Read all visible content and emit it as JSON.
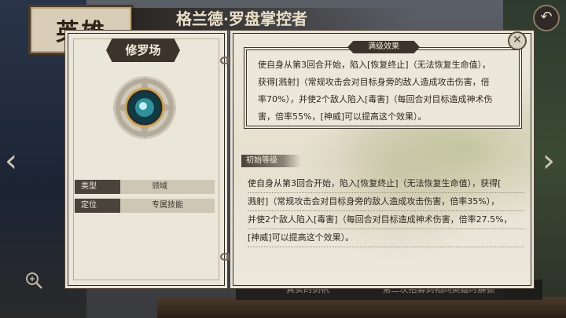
{
  "header": {
    "hero_tab": "英雄",
    "hero_name": "格兰德·罗盘掌控者",
    "back_icon": "↶"
  },
  "skill": {
    "name": "修罗场",
    "info": [
      {
        "key": "类型",
        "value": "领域"
      },
      {
        "key": "定位",
        "value": "专属技能"
      }
    ]
  },
  "max_level": {
    "label": "满级效果",
    "lines": [
      "使自身从第3回合开始，陷入[恢复终止]（无法恢复生命值），",
      "获得[溅射]（常规攻击会对目标身旁的敌人造成攻击伤害，倍",
      "率70%），并使2个敌人陷入[毒害]（每回合对目标造成神术伤",
      "害，倍率55%，[神威]可以提高这个效果）。"
    ]
  },
  "initial_level": {
    "label": "初始等级",
    "lines": [
      "使自身从第3回合开始，陷入[恢复终止]（无法恢复生命值），获得[",
      "溅射]（常规攻击会对目标身旁的敌人造成攻击伤害，倍率35%），",
      "并使2个敌人陷入[毒害]（每回合对目标造成神术伤害，倍率27.5%，",
      "[神威]可以提高这个效果）。"
    ]
  },
  "footer": {
    "hint_left": "真实的剑帆",
    "hint_mid": "第二次招募到相同英雄时解锁"
  },
  "colors": {
    "panel_bg": "#ebe6da",
    "dark_tag": "#3c342c",
    "text": "#2e2720"
  }
}
